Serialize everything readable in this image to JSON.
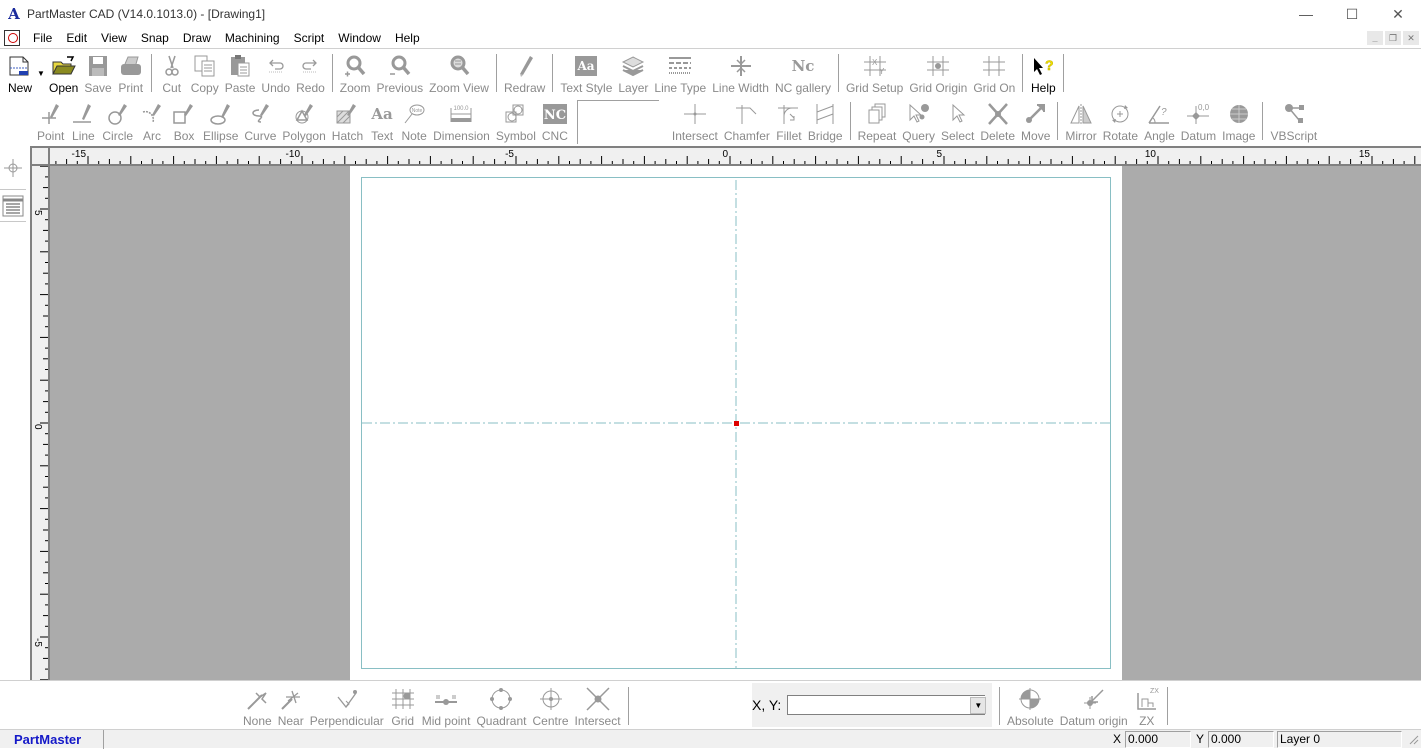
{
  "window": {
    "title": "PartMaster CAD (V14.0.1013.0) - [Drawing1]",
    "controls": {
      "minimize": "—",
      "maximize": "☐",
      "close": "✕"
    },
    "mdi_controls": {
      "minimize": "_",
      "restore": "❐",
      "close": "✕"
    }
  },
  "menubar": {
    "items": [
      "File",
      "Edit",
      "View",
      "Snap",
      "Draw",
      "Machining",
      "Script",
      "Window",
      "Help"
    ]
  },
  "toolbar1": {
    "groups": [
      [
        {
          "label": "New",
          "icon": "new-icon",
          "enabled": true,
          "dropdown": true
        },
        {
          "label": "Open",
          "icon": "open-folder-icon",
          "enabled": true
        },
        {
          "label": "Save",
          "icon": "save-icon",
          "enabled": false
        },
        {
          "label": "Print",
          "icon": "print-icon",
          "enabled": false
        }
      ],
      [
        {
          "label": "Cut",
          "icon": "cut-icon",
          "enabled": false
        },
        {
          "label": "Copy",
          "icon": "copy-icon",
          "enabled": false
        },
        {
          "label": "Paste",
          "icon": "paste-icon",
          "enabled": false
        },
        {
          "label": "Undo",
          "icon": "undo-icon",
          "enabled": false
        },
        {
          "label": "Redo",
          "icon": "redo-icon",
          "enabled": false
        }
      ],
      [
        {
          "label": "Zoom",
          "icon": "zoom-in-icon",
          "enabled": false
        },
        {
          "label": "Previous",
          "icon": "zoom-previous-icon",
          "enabled": false
        },
        {
          "label": "Zoom View",
          "icon": "zoom-view-icon",
          "enabled": false
        }
      ],
      [
        {
          "label": "Redraw",
          "icon": "pencil-icon",
          "enabled": false
        }
      ],
      [
        {
          "label": "Text Style",
          "icon": "text-style-icon",
          "enabled": false
        },
        {
          "label": "Layer",
          "icon": "layer-icon",
          "enabled": false
        },
        {
          "label": "Line Type",
          "icon": "line-type-icon",
          "enabled": false
        },
        {
          "label": "Line Width",
          "icon": "line-width-icon",
          "enabled": false
        },
        {
          "label": "NC gallery",
          "icon": "nc-gallery-icon",
          "enabled": false
        }
      ],
      [
        {
          "label": "Grid Setup",
          "icon": "grid-setup-icon",
          "enabled": false
        },
        {
          "label": "Grid Origin",
          "icon": "grid-origin-icon",
          "enabled": false
        },
        {
          "label": "Grid On",
          "icon": "grid-on-icon",
          "enabled": false
        }
      ],
      [
        {
          "label": "Help",
          "icon": "help-icon",
          "enabled": true
        }
      ]
    ]
  },
  "toolbar2": {
    "draw_tools": [
      {
        "label": "Point",
        "icon": "point-icon"
      },
      {
        "label": "Line",
        "icon": "line-icon"
      },
      {
        "label": "Circle",
        "icon": "circle-icon"
      },
      {
        "label": "Arc",
        "icon": "arc-icon"
      },
      {
        "label": "Box",
        "icon": "box-icon"
      },
      {
        "label": "Ellipse",
        "icon": "ellipse-icon"
      },
      {
        "label": "Curve",
        "icon": "curve-icon"
      },
      {
        "label": "Polygon",
        "icon": "polygon-icon"
      },
      {
        "label": "Hatch",
        "icon": "hatch-icon"
      },
      {
        "label": "Text",
        "icon": "text-icon"
      },
      {
        "label": "Note",
        "icon": "note-icon"
      },
      {
        "label": "Dimension",
        "icon": "dimension-icon"
      },
      {
        "label": "Symbol",
        "icon": "symbol-icon"
      },
      {
        "label": "CNC",
        "icon": "cnc-icon"
      }
    ],
    "modify_tools": [
      {
        "label": "Intersect",
        "icon": "intersect-icon"
      },
      {
        "label": "Chamfer",
        "icon": "chamfer-icon"
      },
      {
        "label": "Fillet",
        "icon": "fillet-icon"
      },
      {
        "label": "Bridge",
        "icon": "bridge-icon"
      }
    ],
    "edit_tools": [
      {
        "label": "Repeat",
        "icon": "repeat-icon"
      },
      {
        "label": "Query",
        "icon": "query-icon"
      },
      {
        "label": "Select",
        "icon": "select-arrow-icon"
      },
      {
        "label": "Delete",
        "icon": "delete-icon"
      },
      {
        "label": "Move",
        "icon": "move-icon"
      }
    ],
    "transform_tools": [
      {
        "label": "Mirror",
        "icon": "mirror-icon"
      },
      {
        "label": "Rotate",
        "icon": "rotate-icon"
      },
      {
        "label": "Angle",
        "icon": "angle-icon"
      },
      {
        "label": "Datum",
        "icon": "datum-icon"
      },
      {
        "label": "Image",
        "icon": "image-icon"
      }
    ],
    "script_tools": [
      {
        "label": "VBScript",
        "icon": "vbscript-icon"
      }
    ]
  },
  "rulers": {
    "horizontal_labels": [
      "-15",
      "-10",
      "-5",
      "0",
      "5",
      "10",
      "15"
    ],
    "vertical_labels": [
      "5",
      "0",
      "-5"
    ]
  },
  "snapbar": {
    "items": [
      {
        "label": "None",
        "icon": "snap-none-icon"
      },
      {
        "label": "Near",
        "icon": "snap-near-icon"
      },
      {
        "label": "Perpendicular",
        "icon": "snap-perpendicular-icon"
      },
      {
        "label": "Grid",
        "icon": "snap-grid-icon"
      },
      {
        "label": "Mid point",
        "icon": "snap-midpoint-icon"
      },
      {
        "label": "Quadrant",
        "icon": "snap-quadrant-icon"
      },
      {
        "label": "Centre",
        "icon": "snap-centre-icon"
      },
      {
        "label": "Intersect",
        "icon": "snap-intersect-icon"
      }
    ]
  },
  "coord_entry": {
    "label": "X, Y:",
    "value": "",
    "dropdown_arrow": "▼"
  },
  "datumbar": {
    "items": [
      {
        "label": "Absolute",
        "icon": "absolute-icon"
      },
      {
        "label": "Datum origin",
        "icon": "datum-origin-icon"
      },
      {
        "label": "ZX",
        "icon": "zx-plane-icon"
      }
    ]
  },
  "statusbar": {
    "app_name": "PartMaster",
    "x_label": "X",
    "x_value": "0.000",
    "y_label": "Y",
    "y_value": "0.000",
    "layer": "Layer 0"
  },
  "colors": {
    "accent_status": "#1418c8",
    "origin_marker": "#dd0000",
    "construction_line": "#89bfc4",
    "canvas_bg": "#ababab"
  }
}
